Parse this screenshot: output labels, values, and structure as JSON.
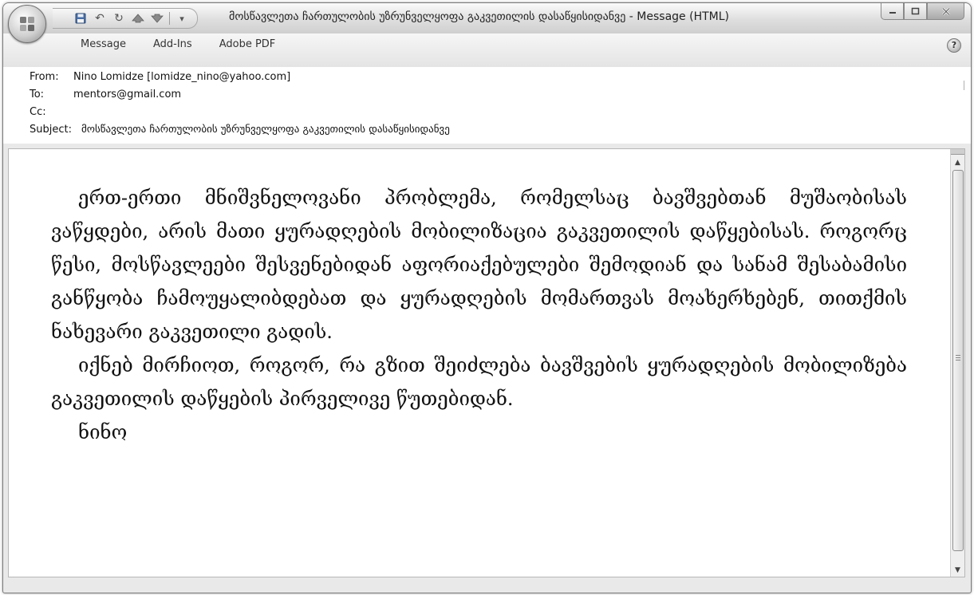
{
  "window": {
    "title": "მოსწავლეთა ჩართულობის უზრუნველყოფა გაკვეთილის დასაწყისიდანვე - Message (HTML)"
  },
  "ribbon": {
    "tabs": [
      "Message",
      "Add-Ins",
      "Adobe PDF"
    ]
  },
  "header": {
    "from_label": "From:",
    "from_value": "Nino Lomidze [lomidze_nino@yahoo.com]",
    "to_label": "To:",
    "to_value": "mentors@gmail.com",
    "cc_label": "Cc:",
    "cc_value": "",
    "subject_label": "Subject:",
    "subject_value": "მოსწავლეთა ჩართულობის უზრუნველყოფა გაკვეთილის დასაწყისიდანვე"
  },
  "message": {
    "paragraphs": [
      "ერთ-ერთი მნიშვნელოვანი პრობლემა, რომელსაც ბავშვებთან მუშაობისას ვაწყდები, არის მათი ყურადღების მობილიზაცია გაკვეთილის დაწყებისას. როგორც წესი, მოსწავლეები შესვენებიდან აფორიაქებულები შემოდიან და სანამ შესაბამისი განწყობა ჩამოუყალიბდებათ და ყურადღების მომართვას მოახერხებენ, თითქმის ნახევარი გაკვეთილი გადის.",
      "იქნებ მირჩიოთ, როგორ, რა გზით შეიძლება ბავშვების ყურადღების მობილიზება გაკვეთილის დაწყების პირველივე წუთებიდან."
    ],
    "signature": "ნინო"
  }
}
